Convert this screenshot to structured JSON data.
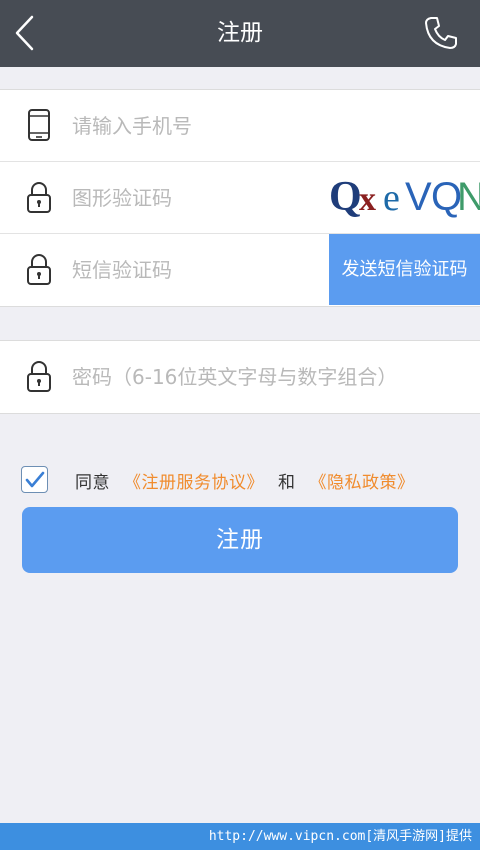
{
  "header": {
    "title": "注册"
  },
  "form": {
    "phone_placeholder": "请输入手机号",
    "captcha_placeholder": "图形验证码",
    "captcha_image_text": "QxeVQN",
    "sms_placeholder": "短信验证码",
    "sms_button": "发送短信验证码",
    "password_placeholder": "密码（6-16位英文字母与数字组合）"
  },
  "agreement": {
    "checked": true,
    "prefix": "同意",
    "terms_link": "《注册服务协议》",
    "conjunction": "和",
    "privacy_link": "《隐私政策》"
  },
  "submit_label": "注册",
  "footer_watermark": "http://www.vipcn.com[清风手游网]提供",
  "colors": {
    "topbar": "#474c54",
    "accent": "#5b9cf0",
    "link": "#f08c2e",
    "background": "#efeff4"
  }
}
